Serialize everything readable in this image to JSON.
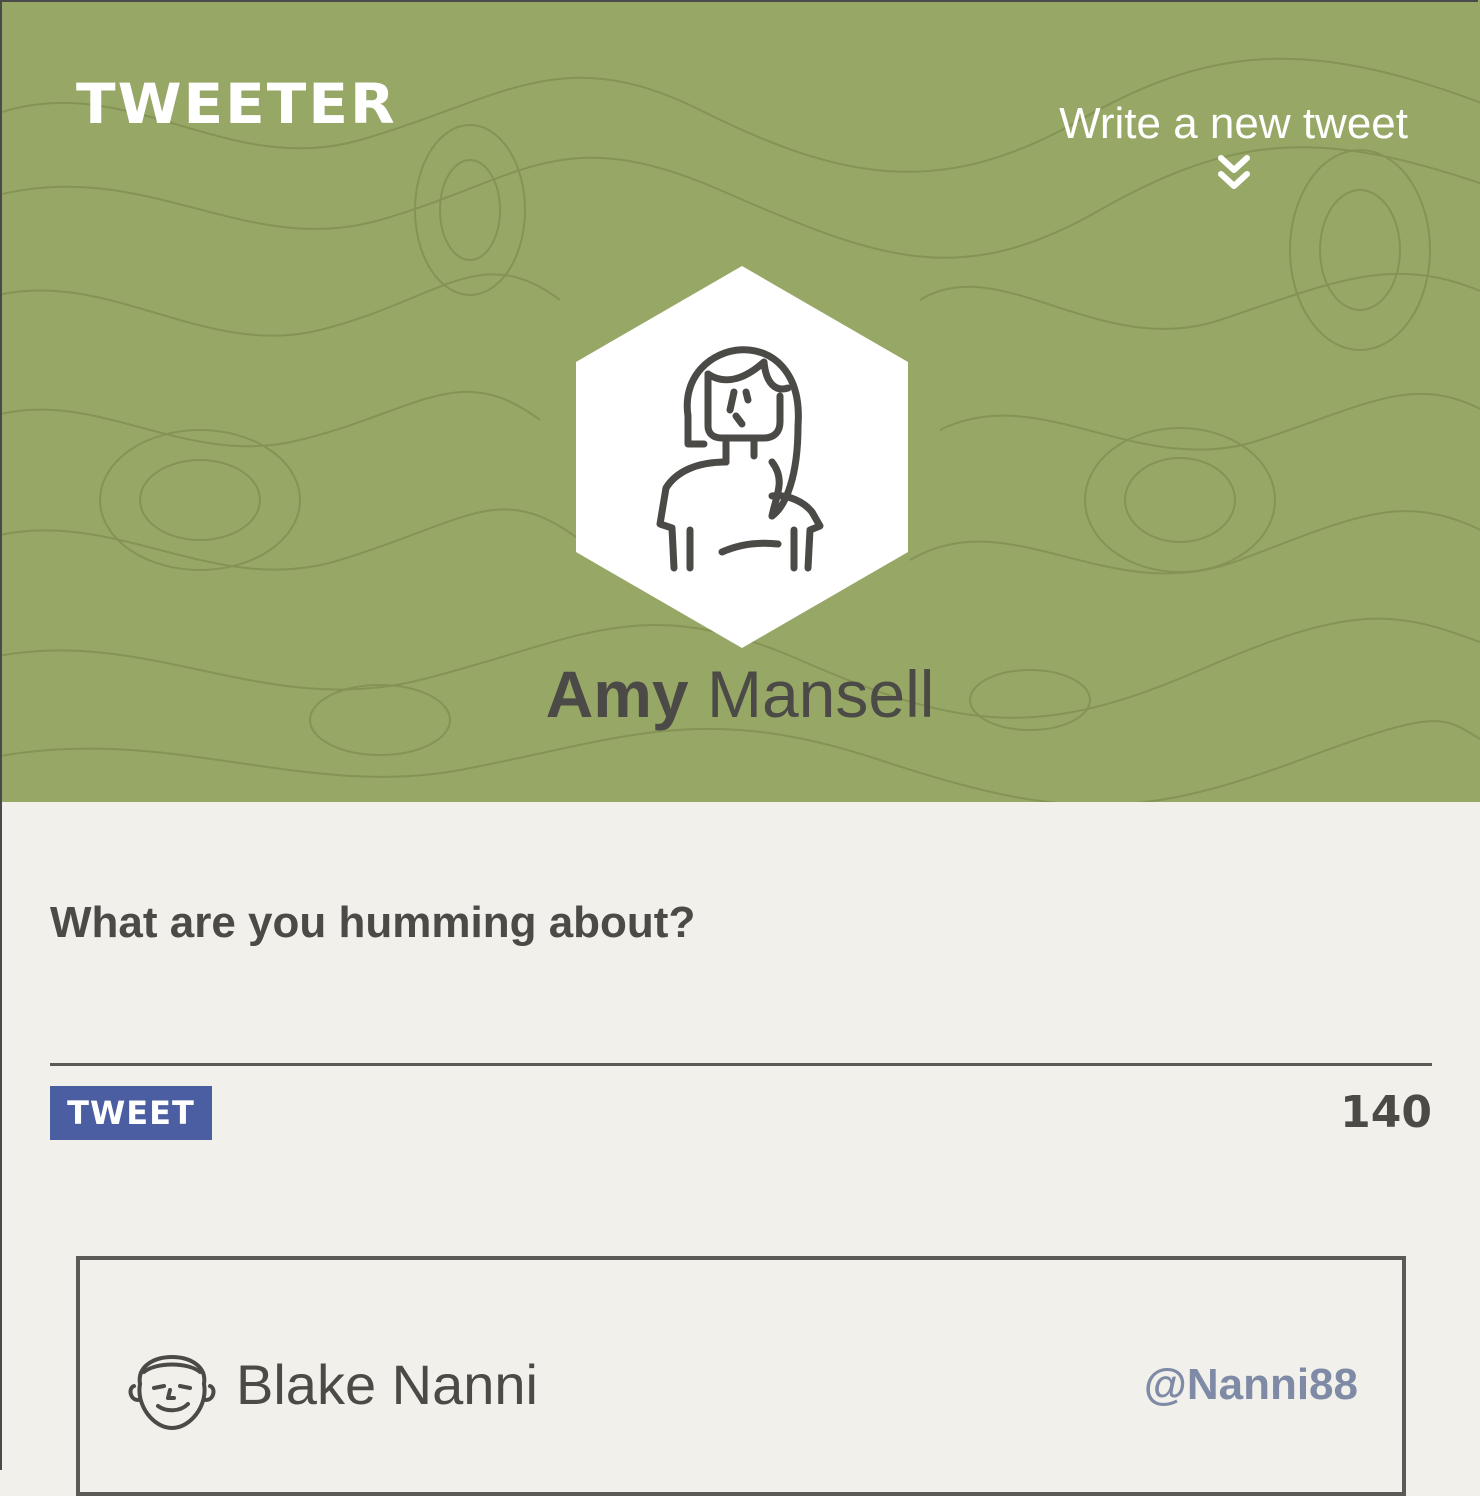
{
  "header": {
    "brand": "TWEETER",
    "write_link": "Write a new tweet",
    "write_link_icon": "double-chevron-down-icon",
    "avatar_icon": "woman-avatar-icon",
    "user_first_name": "Amy",
    "user_last_name": "Mansell"
  },
  "compose": {
    "label": "What are you humming about?",
    "input_value": "",
    "button_label": "TWEET",
    "char_counter": "140"
  },
  "tweets": [
    {
      "avatar_icon": "man-avatar-icon",
      "name": "Blake Nanni",
      "handle": "@Nanni88"
    }
  ],
  "colors": {
    "header_bg": "#97a766",
    "page_bg": "#f2f0eb",
    "button_bg": "#4a5ea1",
    "text_dark": "#4b4a47",
    "handle_color": "#7f8ba6"
  }
}
